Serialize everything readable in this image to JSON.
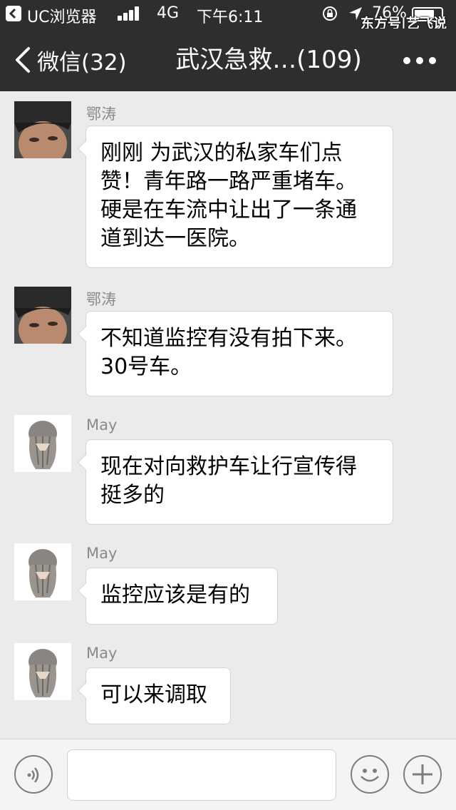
{
  "status_bar": {
    "app_name": "UC浏览器",
    "network": "4G",
    "time": "下午6:11",
    "battery_text": "76%",
    "battery_level": 0.76,
    "watermark": "东方号|艺飞说"
  },
  "nav": {
    "back_label": "微信(32)",
    "title": "武汉急救…(109)"
  },
  "messages": [
    {
      "sender": "鄂涛",
      "lines": [
        "刚刚 为武汉的私家车们点",
        "赞！青年路一路严重堵车。",
        "硬是在车流中让出了一条通",
        "道到达一医院。"
      ]
    },
    {
      "sender": "鄂涛",
      "lines": [
        "不知道监控有没有拍下来。",
        "30号车。"
      ]
    },
    {
      "sender": "May",
      "lines": [
        "现在对向救护车让行宣传得",
        "挺多的"
      ]
    },
    {
      "sender": "May",
      "lines": [
        "监控应该是有的"
      ]
    },
    {
      "sender": "May",
      "lines": [
        "可以来调取"
      ]
    }
  ],
  "input": {
    "value": "",
    "placeholder": ""
  },
  "colors": {
    "nav_bg": "#2e2e2e",
    "chat_bg": "#ebebeb",
    "bubble_bg": "#ffffff",
    "sender_text": "#8a8a8a"
  }
}
